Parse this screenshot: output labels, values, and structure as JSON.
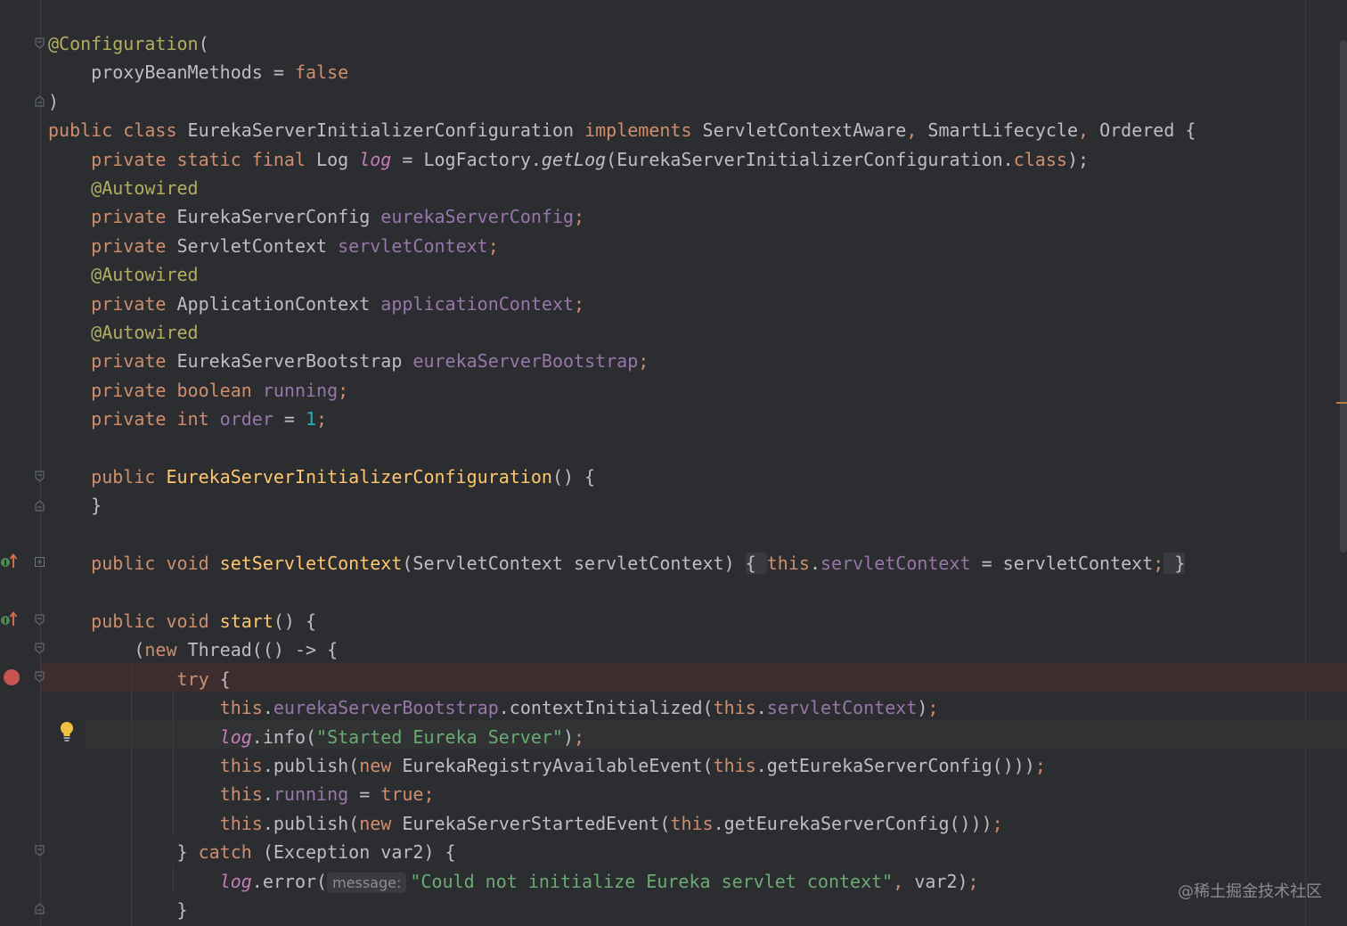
{
  "colors": {
    "background": "#2b2d30",
    "keyword": "#cf8e6d",
    "annotation": "#b3ae60",
    "field": "#c77dbb",
    "method_decl": "#ffc66d",
    "string": "#6aab73",
    "number": "#2aacb8",
    "plain": "#bcbec4",
    "breakpoint": "#c75450"
  },
  "gutter_icons": {
    "implements_marker": "override-up-arrow-icon",
    "breakpoint": "breakpoint-icon",
    "intention": "lightbulb-icon"
  },
  "parameter_hint": "message:",
  "watermark": "@稀土掘金技术社区",
  "lines": [
    {
      "t": [
        [
          "an",
          "@Configuration"
        ],
        [
          "pl",
          "("
        ]
      ]
    },
    {
      "t": [
        [
          "pl",
          "    proxyBeanMethods = "
        ],
        [
          "kw",
          "false"
        ]
      ]
    },
    {
      "t": [
        [
          "pl",
          ")"
        ]
      ]
    },
    {
      "t": [
        [
          "kw",
          "public class "
        ],
        [
          "pl",
          "EurekaServerInitializerConfiguration "
        ],
        [
          "kw",
          "implements "
        ],
        [
          "pl",
          "ServletContextAware"
        ],
        [
          "kw",
          ", "
        ],
        [
          "pl",
          "SmartLifecycle"
        ],
        [
          "kw",
          ", "
        ],
        [
          "pl",
          "Ordered {"
        ]
      ]
    },
    {
      "t": [
        [
          "kw",
          "    private static final "
        ],
        [
          "pl",
          "Log "
        ],
        [
          "sf",
          "log"
        ],
        [
          "pl",
          " = LogFactory."
        ],
        [
          "it",
          "getLog"
        ],
        [
          "pl",
          "(EurekaServerInitializerConfiguration."
        ],
        [
          "kw",
          "class"
        ],
        [
          "pl",
          ");"
        ]
      ]
    },
    {
      "t": [
        [
          "an",
          "    @Autowired"
        ]
      ]
    },
    {
      "t": [
        [
          "kw",
          "    private "
        ],
        [
          "pl",
          "EurekaServerConfig "
        ],
        [
          "fv",
          "eurekaServerConfig"
        ],
        [
          "kw",
          ";"
        ]
      ]
    },
    {
      "t": [
        [
          "kw",
          "    private "
        ],
        [
          "pl",
          "ServletContext "
        ],
        [
          "fv",
          "servletContext"
        ],
        [
          "kw",
          ";"
        ]
      ]
    },
    {
      "t": [
        [
          "an",
          "    @Autowired"
        ]
      ]
    },
    {
      "t": [
        [
          "kw",
          "    private "
        ],
        [
          "pl",
          "ApplicationContext "
        ],
        [
          "fv",
          "applicationContext"
        ],
        [
          "kw",
          ";"
        ]
      ]
    },
    {
      "t": [
        [
          "an",
          "    @Autowired"
        ]
      ]
    },
    {
      "t": [
        [
          "kw",
          "    private "
        ],
        [
          "pl",
          "EurekaServerBootstrap "
        ],
        [
          "fv",
          "eurekaServerBootstrap"
        ],
        [
          "kw",
          ";"
        ]
      ]
    },
    {
      "t": [
        [
          "kw",
          "    private boolean "
        ],
        [
          "fv",
          "running"
        ],
        [
          "kw",
          ";"
        ]
      ]
    },
    {
      "t": [
        [
          "kw",
          "    private int "
        ],
        [
          "fv",
          "order"
        ],
        [
          "pl",
          " = "
        ],
        [
          "nm",
          "1"
        ],
        [
          "kw",
          ";"
        ]
      ]
    },
    {
      "t": [
        [
          "pl",
          ""
        ]
      ]
    },
    {
      "t": [
        [
          "kw",
          "    public "
        ],
        [
          "mn",
          "EurekaServerInitializerConfiguration"
        ],
        [
          "pl",
          "() {"
        ]
      ]
    },
    {
      "t": [
        [
          "pl",
          "    }"
        ]
      ]
    },
    {
      "t": [
        [
          "pl",
          ""
        ]
      ]
    },
    {
      "t": [
        [
          "kw",
          "    public void "
        ],
        [
          "mn",
          "setServletContext"
        ],
        [
          "pl",
          "(ServletContext servletContext) "
        ],
        [
          "box",
          "{ "
        ],
        [
          "kw",
          "this"
        ],
        [
          "pl",
          "."
        ],
        [
          "fv",
          "servletContext"
        ],
        [
          "pl",
          " = servletContext"
        ],
        [
          "kw",
          ";"
        ],
        [
          "box",
          " }"
        ]
      ]
    },
    {
      "t": [
        [
          "pl",
          ""
        ]
      ]
    },
    {
      "t": [
        [
          "kw",
          "    public void "
        ],
        [
          "mn",
          "start"
        ],
        [
          "pl",
          "() {"
        ]
      ]
    },
    {
      "t": [
        [
          "pl",
          "        ("
        ],
        [
          "kw",
          "new "
        ],
        [
          "pl",
          "Thread(() -> {"
        ]
      ]
    },
    {
      "t": [
        [
          "kw",
          "            try "
        ],
        [
          "pl",
          "{"
        ]
      ]
    },
    {
      "t": [
        [
          "kw",
          "                this"
        ],
        [
          "pl",
          "."
        ],
        [
          "fv",
          "eurekaServerBootstrap"
        ],
        [
          "pl",
          ".contextInitialized("
        ],
        [
          "kw",
          "this"
        ],
        [
          "pl",
          "."
        ],
        [
          "fv",
          "servletContext"
        ],
        [
          "pl",
          ")"
        ],
        [
          "kw",
          ";"
        ]
      ]
    },
    {
      "t": [
        [
          "pl",
          "                "
        ],
        [
          "sf",
          "log"
        ],
        [
          "pl",
          ".info("
        ],
        [
          "st",
          "\"Started Eureka Server\""
        ],
        [
          "pl",
          ")"
        ],
        [
          "kw",
          ";"
        ]
      ]
    },
    {
      "t": [
        [
          "kw",
          "                this"
        ],
        [
          "pl",
          ".publish("
        ],
        [
          "kw",
          "new "
        ],
        [
          "pl",
          "EurekaRegistryAvailableEvent("
        ],
        [
          "kw",
          "this"
        ],
        [
          "pl",
          ".getEurekaServerConfig()))"
        ],
        [
          "kw",
          ";"
        ]
      ]
    },
    {
      "t": [
        [
          "kw",
          "                this"
        ],
        [
          "pl",
          "."
        ],
        [
          "fv",
          "running"
        ],
        [
          "pl",
          " = "
        ],
        [
          "kw",
          "true;"
        ]
      ]
    },
    {
      "t": [
        [
          "kw",
          "                this"
        ],
        [
          "pl",
          ".publish("
        ],
        [
          "kw",
          "new "
        ],
        [
          "pl",
          "EurekaServerStartedEvent("
        ],
        [
          "kw",
          "this"
        ],
        [
          "pl",
          ".getEurekaServerConfig()))"
        ],
        [
          "kw",
          ";"
        ]
      ]
    },
    {
      "t": [
        [
          "pl",
          "            } "
        ],
        [
          "kw",
          "catch "
        ],
        [
          "pl",
          "(Exception var2) {"
        ]
      ]
    },
    {
      "t": [
        [
          "pl",
          "                "
        ],
        [
          "sf",
          "log"
        ],
        [
          "pl",
          ".error("
        ],
        [
          "hint",
          "message:"
        ],
        [
          "st",
          "\"Could not initialize Eureka servlet context\""
        ],
        [
          "kw",
          ", "
        ],
        [
          "pl",
          "var2)"
        ],
        [
          "kw",
          ";"
        ]
      ]
    },
    {
      "t": [
        [
          "pl",
          "            }"
        ]
      ]
    }
  ]
}
